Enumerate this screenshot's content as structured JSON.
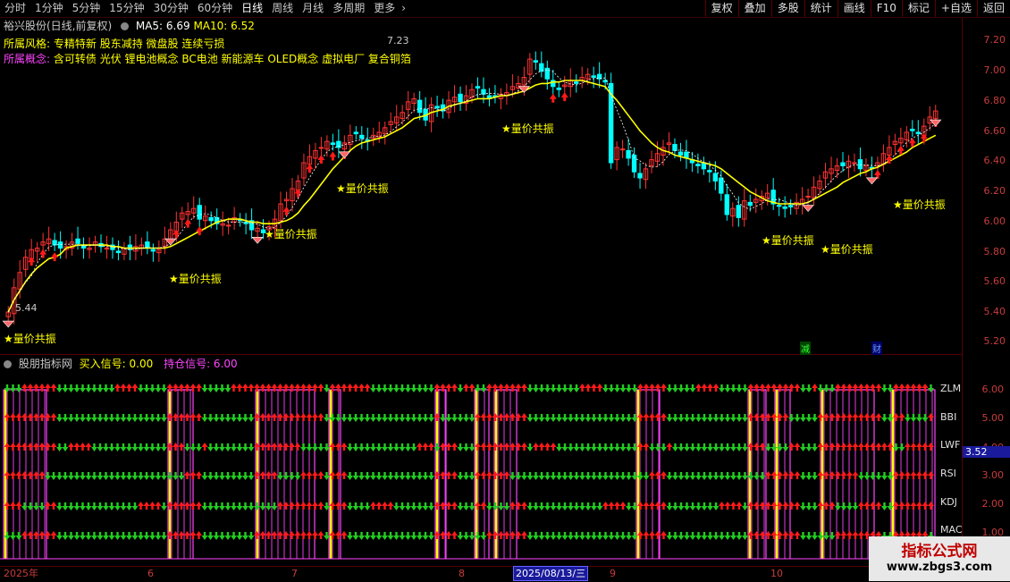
{
  "toolbar": {
    "periods": [
      "分时",
      "1分钟",
      "5分钟",
      "15分钟",
      "30分钟",
      "60分钟",
      "日线",
      "周线",
      "月线",
      "多周期",
      "更多"
    ],
    "active_period": "日线",
    "right_buttons": [
      "复权",
      "叠加",
      "多股",
      "统计",
      "画线",
      "F10",
      "标记",
      "+自选",
      "返回"
    ]
  },
  "stock": {
    "title": "裕兴股份(日线,前复权)",
    "ma5_label": "MA5: 6.69",
    "ma10_label": "MA10: 6.52",
    "style_label": "所属风格:",
    "style_value": "专精特新 股东减持 微盘股 连续亏损",
    "concept_label": "所属概念:",
    "concept_value": "含可转债 光伏 锂电池概念 BC电池 新能源车 OLED概念 虚拟电厂 复合铜箔",
    "high_mark": "7.23",
    "low_mark": "5.44"
  },
  "price_axis": [
    "7.20",
    "7.00",
    "6.80",
    "6.60",
    "6.40",
    "6.20",
    "6.00",
    "5.80",
    "5.60",
    "5.40",
    "5.20"
  ],
  "annotation_text": "★量价共振",
  "event_marks": [
    "减",
    "财"
  ],
  "indicator": {
    "name": "股朋指标网",
    "buy_signal": "买入信号: 0.00",
    "hold_signal": "持仓信号: 6.00",
    "lines": [
      "ZLM",
      "BBI",
      "LWF",
      "RSI",
      "KDJ",
      "MAC"
    ],
    "axis": [
      "6.00",
      "5.00",
      "4.00",
      "3.00",
      "2.00",
      "1.00"
    ],
    "current_value": "3.52"
  },
  "date_axis": {
    "labels": [
      "2025年",
      "6",
      "7",
      "8",
      "9",
      "10"
    ],
    "cursor_date": "2025/08/13/三"
  },
  "watermark": {
    "title": "指标公式网",
    "url": "www.zbgs3.com"
  },
  "colors": {
    "up": "#ff3333",
    "down": "#00ffff",
    "ma5": "#ffffff",
    "ma10": "#ffff00",
    "buy_arrow": "#ff1a1a",
    "sell_arrow": "#22cc22",
    "hold_line": "#ff44ff",
    "signal_bar": "#ffff00"
  },
  "chart_data": {
    "type": "candlestick",
    "price_range": [
      5.2,
      7.3
    ],
    "closes": [
      5.44,
      5.6,
      5.7,
      5.8,
      5.85,
      5.86,
      5.9,
      5.92,
      5.88,
      5.86,
      5.87,
      5.9,
      5.89,
      5.86,
      5.86,
      5.9,
      5.87,
      5.86,
      5.85,
      5.83,
      5.86,
      5.85,
      5.87,
      5.88,
      5.86,
      5.84,
      5.85,
      5.92,
      5.98,
      6.03,
      6.09,
      6.1,
      6.12,
      6.05,
      6.07,
      6.04,
      6.02,
      6.02,
      6.01,
      6.06,
      6.04,
      6.02,
      5.98,
      5.99,
      5.96,
      6.0,
      6.05,
      6.15,
      6.18,
      6.25,
      6.3,
      6.42,
      6.46,
      6.5,
      6.52,
      6.56,
      6.54,
      6.52,
      6.55,
      6.6,
      6.61,
      6.58,
      6.56,
      6.6,
      6.62,
      6.65,
      6.69,
      6.72,
      6.75,
      6.82,
      6.84,
      6.75,
      6.7,
      6.8,
      6.78,
      6.76,
      6.83,
      6.85,
      6.82,
      6.86,
      6.9,
      6.91,
      6.87,
      6.84,
      6.85,
      6.87,
      6.88,
      6.92,
      6.94,
      6.98,
      7.1,
      7.08,
      7.02,
      6.97,
      6.92,
      6.9,
      6.93,
      6.96,
      6.94,
      6.98,
      7.0,
      6.98,
      6.97,
      6.95,
      6.42,
      6.52,
      6.51,
      6.45,
      6.36,
      6.32,
      6.38,
      6.44,
      6.48,
      6.52,
      6.55,
      6.5,
      6.47,
      6.45,
      6.42,
      6.4,
      6.38,
      6.36,
      6.3,
      6.22,
      6.08,
      6.12,
      6.06,
      6.17,
      6.14,
      6.18,
      6.2,
      6.22,
      6.15,
      6.14,
      6.12,
      6.13,
      6.16,
      6.18,
      6.2,
      6.26,
      6.3,
      6.36,
      6.38,
      6.4,
      6.4,
      6.43,
      6.42,
      6.38,
      6.4,
      6.38,
      6.42,
      6.48,
      6.52,
      6.56,
      6.58,
      6.62,
      6.63,
      6.61,
      6.66,
      6.72,
      6.76
    ],
    "ma10": [
      5.44,
      5.52,
      5.58,
      5.64,
      5.69,
      5.73,
      5.76,
      5.79,
      5.8,
      5.82,
      5.86,
      5.87,
      5.88,
      5.88,
      5.88,
      5.88,
      5.88,
      5.88,
      5.87,
      5.87,
      5.86,
      5.86,
      5.86,
      5.86,
      5.86,
      5.86,
      5.86,
      5.86,
      5.87,
      5.89,
      5.91,
      5.93,
      5.95,
      5.97,
      5.99,
      6.01,
      6.03,
      6.04,
      6.05,
      6.05,
      6.05,
      6.04,
      6.03,
      6.03,
      6.02,
      6.02,
      6.02,
      6.03,
      6.04,
      6.06,
      6.09,
      6.14,
      6.18,
      6.23,
      6.28,
      6.33,
      6.38,
      6.42,
      6.46,
      6.5,
      6.53,
      6.55,
      6.56,
      6.57,
      6.58,
      6.59,
      6.61,
      6.63,
      6.65,
      6.68,
      6.71,
      6.72,
      6.73,
      6.75,
      6.76,
      6.77,
      6.79,
      6.8,
      6.81,
      6.82,
      6.83,
      6.84,
      6.84,
      6.84,
      6.85,
      6.86,
      6.86,
      6.87,
      6.88,
      6.89,
      6.91,
      6.93,
      6.94,
      6.94,
      6.95,
      6.95,
      6.96,
      6.96,
      6.96,
      6.96,
      6.95,
      6.94,
      6.93,
      6.92,
      6.87,
      6.83,
      6.78,
      6.73,
      6.68,
      6.63,
      6.59,
      6.55,
      6.52,
      6.5,
      6.49,
      6.47,
      6.46,
      6.45,
      6.44,
      6.43,
      6.42,
      6.41,
      6.4,
      6.38,
      6.35,
      6.32,
      6.29,
      6.26,
      6.23,
      6.21,
      6.19,
      6.17,
      6.16,
      6.15,
      6.15,
      6.15,
      6.15,
      6.15,
      6.16,
      6.18,
      6.2,
      6.22,
      6.24,
      6.26,
      6.29,
      6.31,
      6.33,
      6.35,
      6.36,
      6.38,
      6.39,
      6.41,
      6.43,
      6.45,
      6.47,
      6.49,
      6.52,
      6.54,
      6.56,
      6.58,
      6.6
    ]
  }
}
